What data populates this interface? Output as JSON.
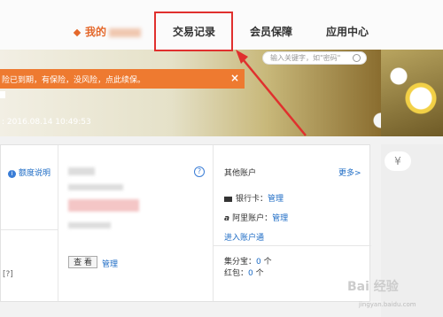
{
  "nav": {
    "mine": "我的",
    "trade": "交易记录",
    "member": "会员保障",
    "apps": "应用中心"
  },
  "search": {
    "placeholder": "输入关键字，如\"密码\""
  },
  "alert": {
    "text": "险已到期，有保险，没风险，点此续保。",
    "close": "×"
  },
  "last_login": ": 2016.08.14 10:49:53",
  "panel_left": {
    "quota_help": "额度说明",
    "bracket_q": "[?]"
  },
  "panel_mid": {
    "view_button": "查 看",
    "manage_link": "管理",
    "help_icon": "?"
  },
  "panel_right": {
    "title": "其他账户",
    "more": "更多>",
    "bank_label": "银行卡：",
    "bank_manage": "管理",
    "ali_label": "阿里账户：",
    "ali_manage": "管理",
    "enter_link": "进入账户通",
    "jifen_label": "集分宝：",
    "jifen_value": "0",
    "jifen_unit": "个",
    "hongbao_label": "红包：",
    "hongbao_value": "0",
    "hongbao_unit": "个"
  },
  "side": {
    "yen": "¥"
  },
  "watermark": {
    "main": "Bai 经验",
    "sub": "jingyan.baidu.com"
  },
  "colors": {
    "accent": "#e4682b",
    "alert": "#ee7a30",
    "link": "#1c6bc5",
    "highlight": "#e0302e"
  }
}
